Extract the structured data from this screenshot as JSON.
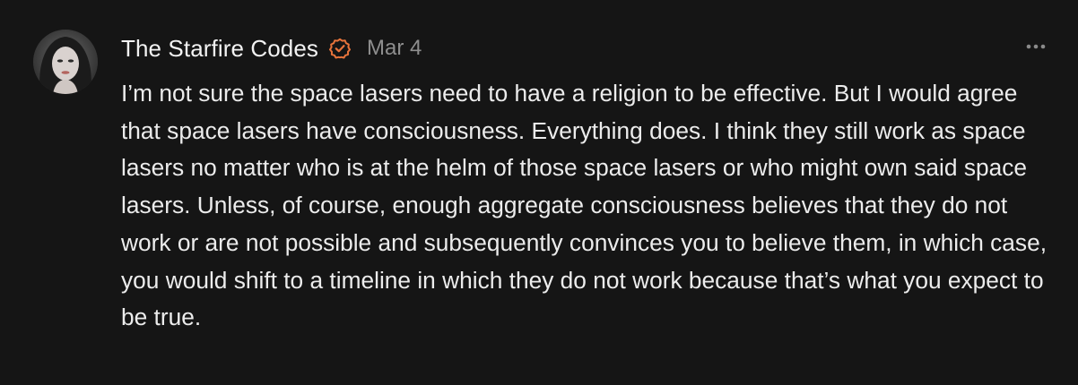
{
  "comment": {
    "author": "The Starfire Codes",
    "verified_badge_icon": "verified-check-icon",
    "accent_color": "#e8743b",
    "date": "Mar 4",
    "more_icon": "more-horizontal-icon",
    "text": "I’m not sure the space lasers need to have a religion to be effective. But I would agree that space lasers have consciousness. Everything does. I think they still work as space lasers no matter who is at the helm of those space lasers or who might own said space lasers. Unless, of course, enough aggregate consciousness believes that they do not work or are not possible and subsequently convinces you to believe them, in which case, you would shift to a timeline in which they do not work because that’s what you expect to be true."
  }
}
